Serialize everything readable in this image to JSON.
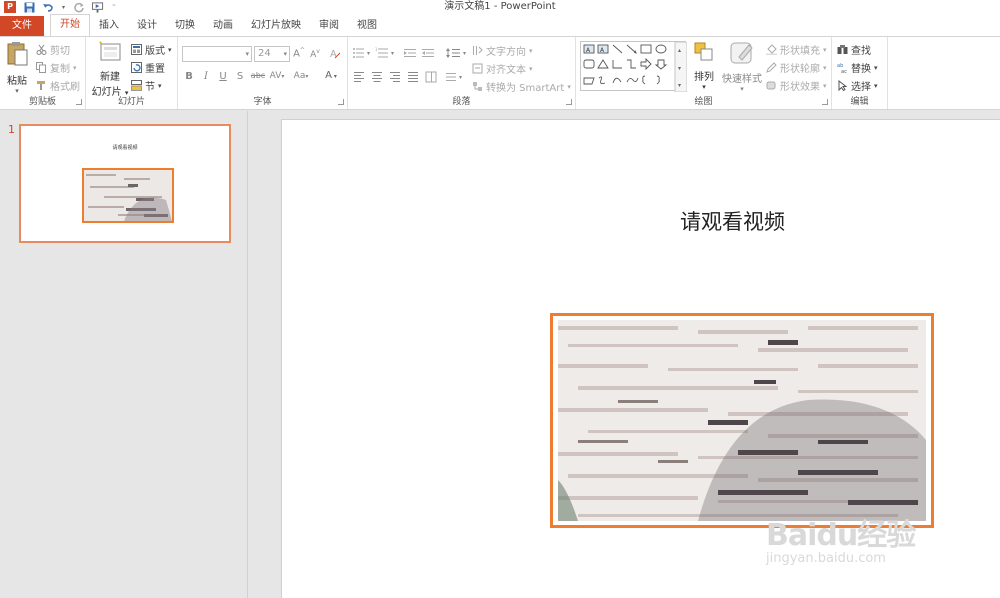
{
  "window": {
    "title": "演示文稿1 - PowerPoint",
    "app_icon": "P"
  },
  "tabs": [
    {
      "label": "文件"
    },
    {
      "label": "开始"
    },
    {
      "label": "插入"
    },
    {
      "label": "设计"
    },
    {
      "label": "切换"
    },
    {
      "label": "动画"
    },
    {
      "label": "幻灯片放映"
    },
    {
      "label": "审阅"
    },
    {
      "label": "视图"
    }
  ],
  "ribbon": {
    "clipboard": {
      "paste": "粘贴",
      "cut": "剪切",
      "copy": "复制",
      "format_painter": "格式刷",
      "label": "剪贴板"
    },
    "slides": {
      "new_slide_1": "新建",
      "new_slide_2": "幻灯片",
      "layout": "版式",
      "reset": "重置",
      "section": "节",
      "label": "幻灯片"
    },
    "font": {
      "size": "24",
      "label": "字体",
      "bold": "B",
      "italic": "I",
      "underline": "U",
      "shadow": "S",
      "strike": "abc",
      "spacing": "AV",
      "case": "Aa",
      "color": "A",
      "grow": "A",
      "shrink": "A"
    },
    "paragraph": {
      "text_direction": "文字方向",
      "align_text": "对齐文本",
      "smartart": "转换为 SmartArt",
      "label": "段落"
    },
    "drawing": {
      "arrange": "排列",
      "quick_styles": "快速样式",
      "shape_fill": "形状填充",
      "shape_outline": "形状轮廓",
      "shape_effects": "形状效果",
      "label": "绘图"
    },
    "editing": {
      "find": "查找",
      "replace": "替换",
      "select": "选择",
      "label": "编辑"
    }
  },
  "thumbnails": [
    {
      "number": "1",
      "title": "请观看视频"
    }
  ],
  "slide": {
    "title": "请观看视频"
  },
  "watermark": {
    "main": "Baidu经验",
    "sub": "jingyan.baidu.com"
  },
  "colors": {
    "accent": "#d24726",
    "video_border": "#ed7d31"
  }
}
